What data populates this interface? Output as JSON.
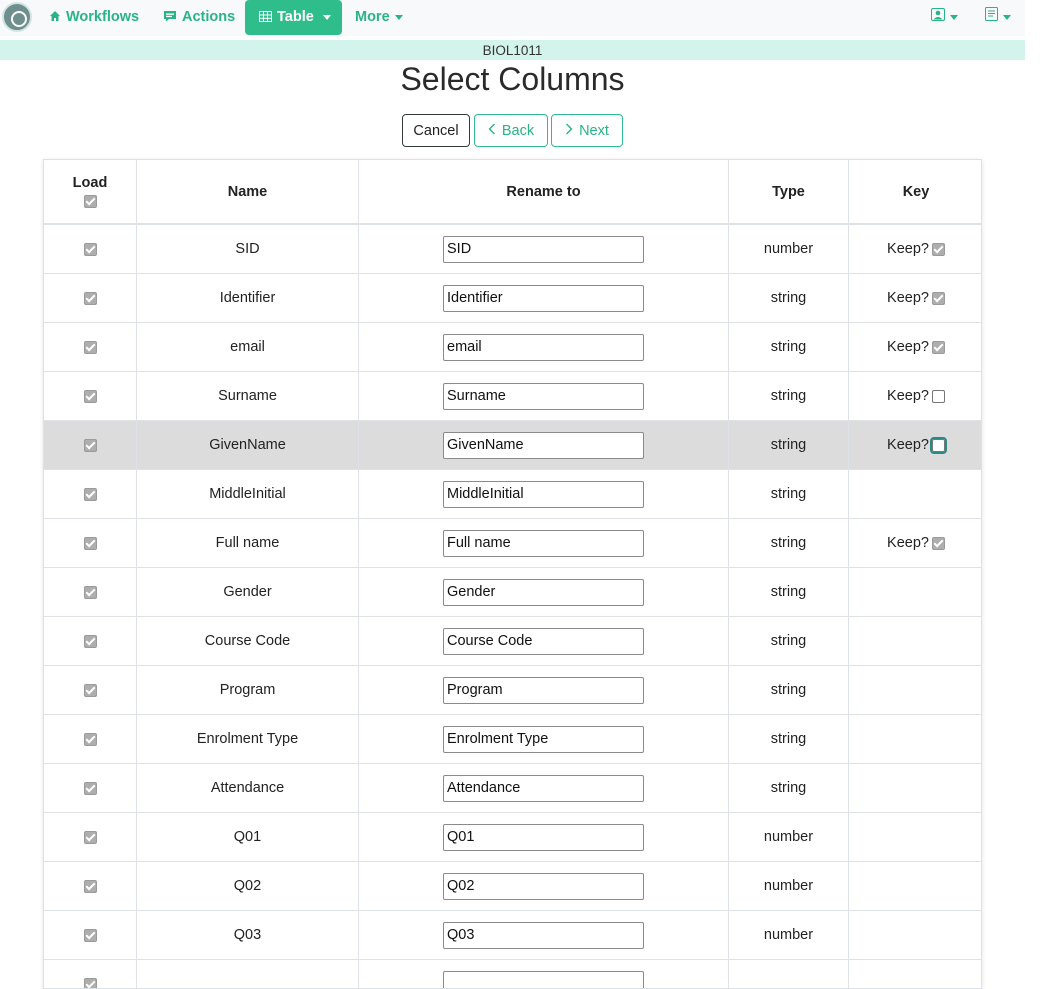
{
  "nav": {
    "workflows": "Workflows",
    "actions": "Actions",
    "table": "Table",
    "more": "More"
  },
  "course": "BIOL1011",
  "title": "Select Columns",
  "buttons": {
    "cancel": "Cancel",
    "back": "Back",
    "next": "Next"
  },
  "table": {
    "headers": {
      "load": "Load",
      "name": "Name",
      "rename": "Rename to",
      "type": "Type",
      "key": "Key"
    },
    "keep_label": "Keep?",
    "rows": [
      {
        "name": "SID",
        "rename": "SID",
        "type": "number",
        "keep": "checked"
      },
      {
        "name": "Identifier",
        "rename": "Identifier",
        "type": "string",
        "keep": "checked"
      },
      {
        "name": "email",
        "rename": "email",
        "type": "string",
        "keep": "checked"
      },
      {
        "name": "Surname",
        "rename": "Surname",
        "type": "string",
        "keep": "unchecked"
      },
      {
        "name": "GivenName",
        "rename": "GivenName",
        "type": "string",
        "keep": "unchecked",
        "highlighted": true
      },
      {
        "name": "MiddleInitial",
        "rename": "MiddleInitial",
        "type": "string",
        "keep": "none"
      },
      {
        "name": "Full name",
        "rename": "Full name",
        "type": "string",
        "keep": "checked"
      },
      {
        "name": "Gender",
        "rename": "Gender",
        "type": "string",
        "keep": "none"
      },
      {
        "name": "Course Code",
        "rename": "Course Code",
        "type": "string",
        "keep": "none"
      },
      {
        "name": "Program",
        "rename": "Program",
        "type": "string",
        "keep": "none"
      },
      {
        "name": "Enrolment Type",
        "rename": "Enrolment Type",
        "type": "string",
        "keep": "none"
      },
      {
        "name": "Attendance",
        "rename": "Attendance",
        "type": "string",
        "keep": "none"
      },
      {
        "name": "Q01",
        "rename": "Q01",
        "type": "number",
        "keep": "none"
      },
      {
        "name": "Q02",
        "rename": "Q02",
        "type": "number",
        "keep": "none"
      },
      {
        "name": "Q03",
        "rename": "Q03",
        "type": "number",
        "keep": "none"
      },
      {
        "name": "",
        "rename": "",
        "type": "",
        "keep": "none"
      }
    ]
  },
  "icons": {
    "workflows": "home-icon",
    "actions": "comment-icon",
    "table": "table-icon",
    "user": "user-icon",
    "docs": "book-icon",
    "back": "chevron-left-icon",
    "next": "chevron-right-icon"
  },
  "colors": {
    "accent": "#2fbd8b",
    "course_bar": "#d3f4eb",
    "highlight_row": "#dcdcdc"
  }
}
